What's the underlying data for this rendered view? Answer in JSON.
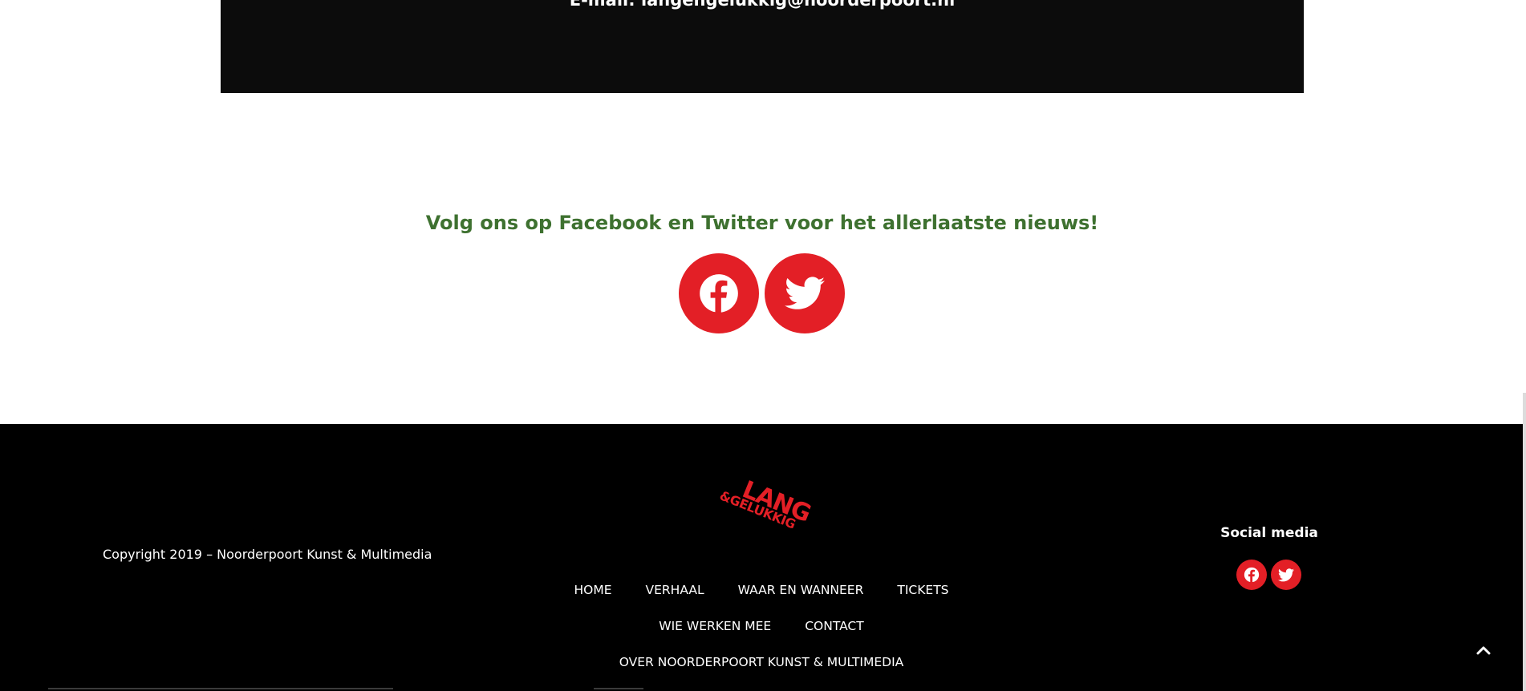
{
  "contact": {
    "email_line": "E-mail: langengelukkig@noorderpoort.nl"
  },
  "follow": {
    "heading": "Volg ons op Facebook en Twitter voor het allerlaatste nieuws!",
    "icons": [
      "facebook-icon",
      "twitter-icon"
    ]
  },
  "footer": {
    "copyright": "Copyright 2019 – Noorderpoort Kunst & Multimedia",
    "logo": {
      "line1": "LANG",
      "line2": "&GELUKKIG"
    },
    "nav": {
      "home": "HOME",
      "verhaal": "VERHAAL",
      "waar_en_wanneer": "WAAR EN WANNEER",
      "tickets": "TICKETS",
      "wie_werken_mee": "WIE WERKEN MEE",
      "contact": "CONTACT",
      "over": "OVER NOORDERPOORT KUNST & MULTIMEDIA"
    },
    "social_title": "Social media"
  },
  "colors": {
    "accent_red": "#e31f26",
    "heading_green": "#3e7130",
    "footer_bg": "#000000",
    "contact_bg": "#0c0c0c"
  }
}
